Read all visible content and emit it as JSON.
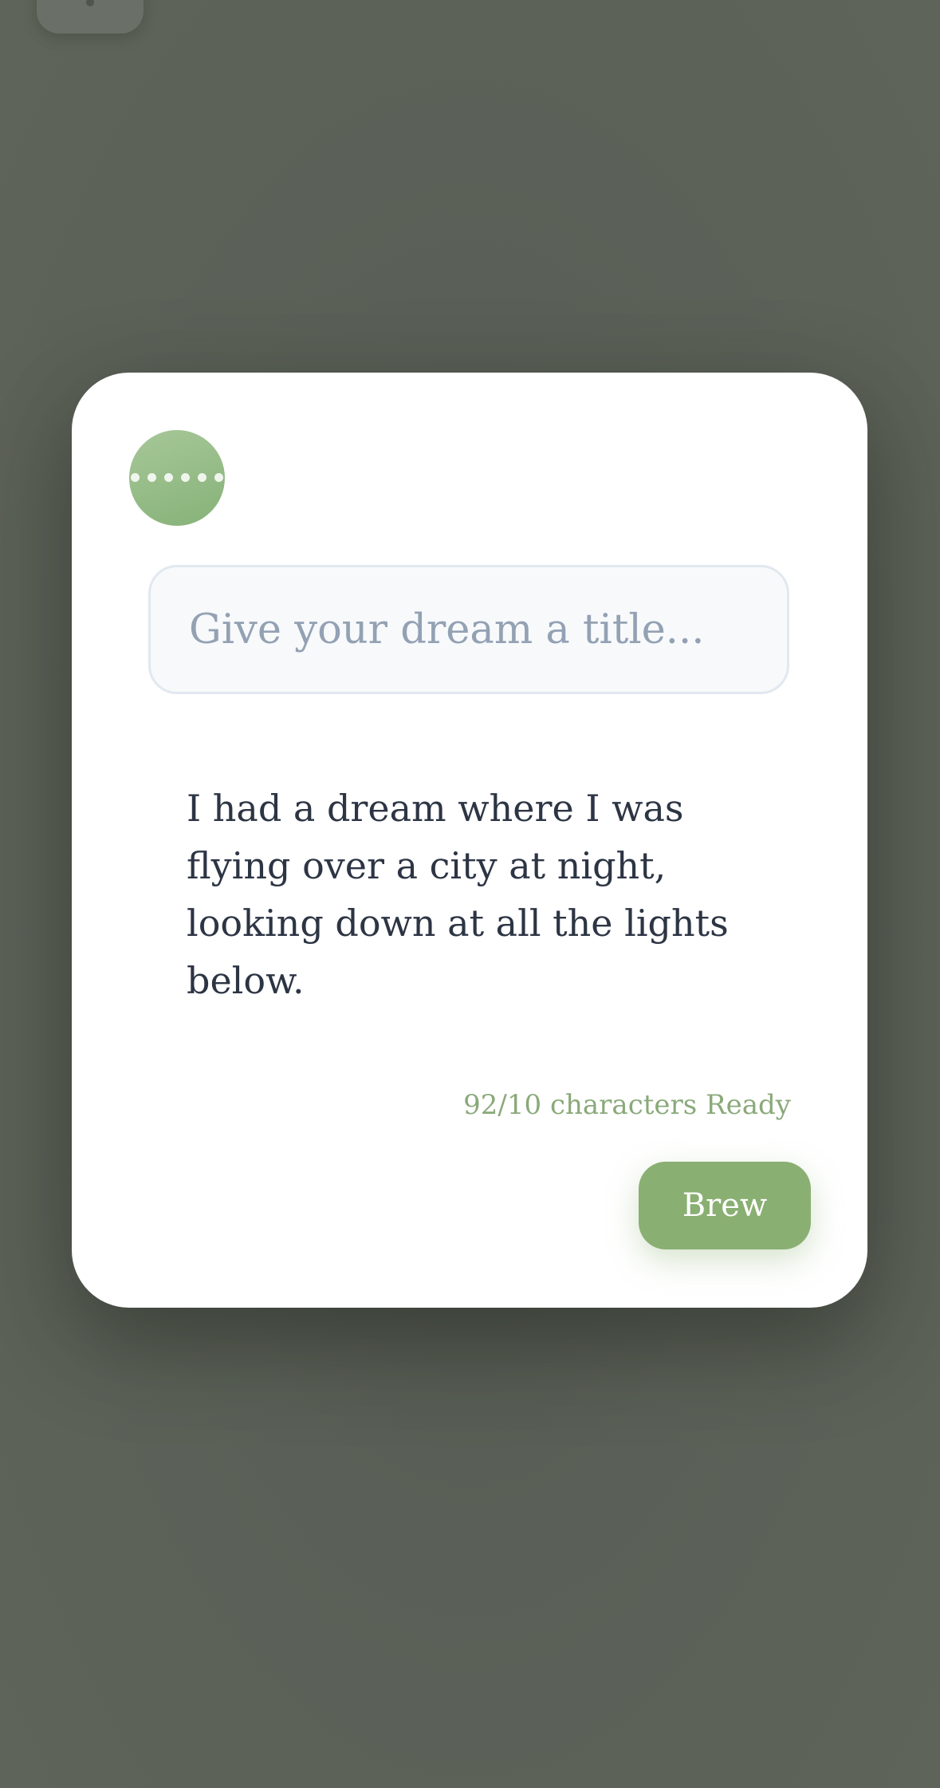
{
  "title_input": {
    "value": "",
    "placeholder": "Give your dream a title..."
  },
  "dream": {
    "text": "I had a dream where I was flying over a city at night, looking down at all the lights below."
  },
  "counter": {
    "text": "92/10 characters Ready"
  },
  "actions": {
    "brew_label": "Brew"
  },
  "colors": {
    "accent": "#8aaf72",
    "counter": "#8aa97a",
    "backdrop": "#5d635a"
  },
  "icons": {
    "avatar": "moon-dots-avatar-icon"
  }
}
